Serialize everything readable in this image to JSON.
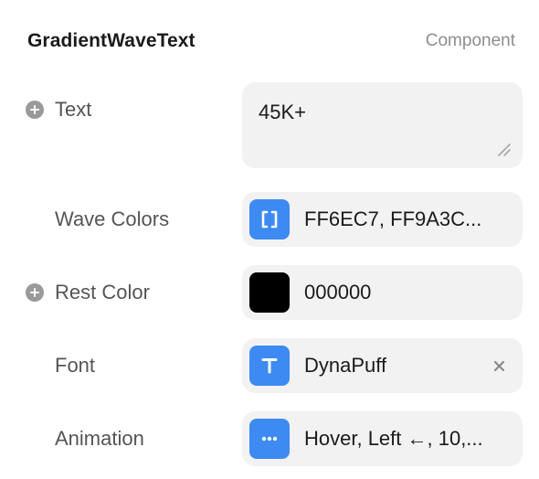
{
  "header": {
    "title": "GradientWaveText",
    "kind": "Component"
  },
  "rows": {
    "text": {
      "label": "Text",
      "value": "45K+"
    },
    "wave_colors": {
      "label": "Wave Colors",
      "value": "FF6EC7, FF9A3C...",
      "icon": "array-bracket-icon"
    },
    "rest_color": {
      "label": "Rest Color",
      "value": "000000",
      "swatch": "#000000"
    },
    "font": {
      "label": "Font",
      "value": "DynaPuff",
      "icon": "font-t-icon"
    },
    "animation": {
      "label": "Animation",
      "value": "Hover, Left ←, 10,...",
      "icon": "ellipsis-icon"
    }
  },
  "colors": {
    "accent": "#3d8bf2",
    "field_bg": "#f2f2f2",
    "label": "#555555",
    "muted": "#8e8e8e"
  }
}
